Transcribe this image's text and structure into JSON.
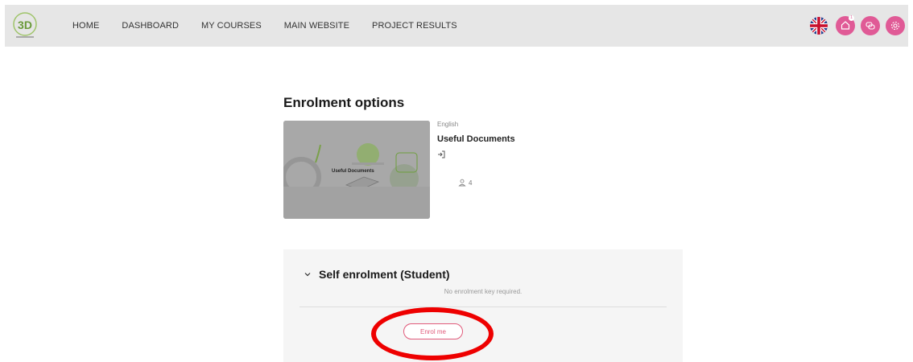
{
  "nav": {
    "items": [
      {
        "label": "HOME"
      },
      {
        "label": "DASHBOARD"
      },
      {
        "label": "MY COURSES"
      },
      {
        "label": "MAIN WEBSITE"
      },
      {
        "label": "PROJECT RESULTS"
      }
    ],
    "logo_text": "3D",
    "notification_count": "1"
  },
  "page": {
    "title": "Enrolment options"
  },
  "course": {
    "language": "English",
    "name": "Useful Documents",
    "image_title": "Useful Documents",
    "participants": "4"
  },
  "enrolment": {
    "method_title": "Self enrolment (Student)",
    "note": "No enrolment key required.",
    "button_label": "Enrol me"
  },
  "colors": {
    "accent": "#e05a96",
    "button_border": "#e05a7a",
    "highlight": "#ee0000",
    "topbar": "#e6e6e6"
  },
  "icons": [
    "uk-flag-icon",
    "notification-icon",
    "chat-icon",
    "settings-icon",
    "enter-icon",
    "participants-icon",
    "chevron-down-icon"
  ]
}
